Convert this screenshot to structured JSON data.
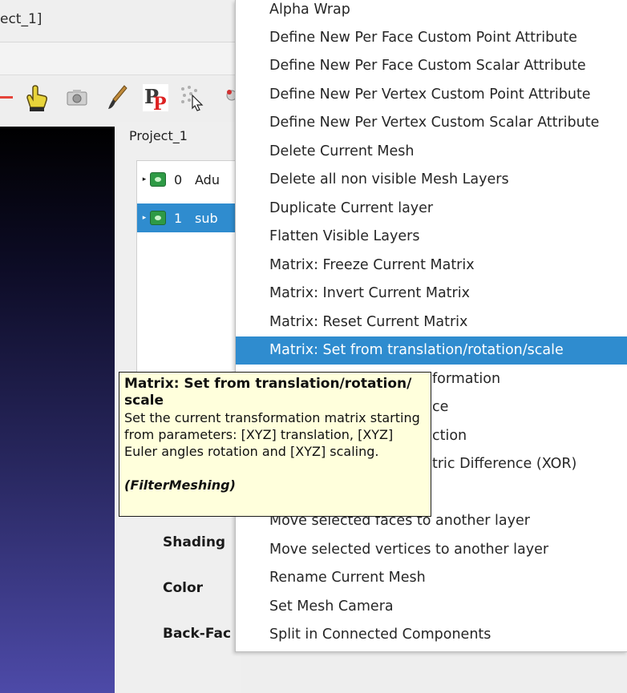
{
  "window": {
    "title": "ect_1]"
  },
  "project": {
    "label": "Project_1"
  },
  "layers": [
    {
      "index": "0",
      "name": "Adu",
      "selected": false
    },
    {
      "index": "1",
      "name": "sub",
      "selected": true
    }
  ],
  "properties": {
    "shading": "Shading",
    "color": "Color",
    "backface": "Back-Fac"
  },
  "menu": {
    "items": [
      "Alpha Wrap",
      "Define New Per Face Custom Point Attribute",
      "Define New Per Face Custom Scalar Attribute",
      "Define New Per Vertex Custom Point Attribute",
      "Define New Per Vertex Custom Scalar Attribute",
      "Delete Current Mesh",
      "Delete all non visible Mesh Layers",
      "Duplicate Current layer",
      "Flatten Visible Layers",
      "Matrix: Freeze Current Matrix",
      "Matrix: Invert Current Matrix",
      "Matrix: Reset Current Matrix",
      "Matrix: Set from translation/rotation/scale",
      "formation",
      "ce",
      "ction",
      "tric Difference (XOR)",
      "",
      "Move selected faces to another layer",
      "Move selected vertices to another layer",
      "Rename Current Mesh",
      "Set Mesh Camera",
      "Split in Connected Components"
    ],
    "active_index": 12
  },
  "tooltip": {
    "title": "Matrix: Set from translation/rotation/ scale",
    "description": "Set the current transformation matrix starting from parameters: [XYZ] translation, [XYZ] Euler angles rotation and [XYZ] scaling.",
    "plugin": "(FilterMeshing)"
  },
  "colors": {
    "accent": "#2f8ccf",
    "tooltip_bg": "#ffffdc",
    "viewport_top": "#000000",
    "viewport_bottom": "#4d4aa8"
  },
  "icons": [
    "minus-red-icon",
    "hand-pointer-icon",
    "camera-icon",
    "paint-brush-icon",
    "pp-plugin-icon",
    "select-vertex-icon",
    "paint-tool-icon"
  ]
}
